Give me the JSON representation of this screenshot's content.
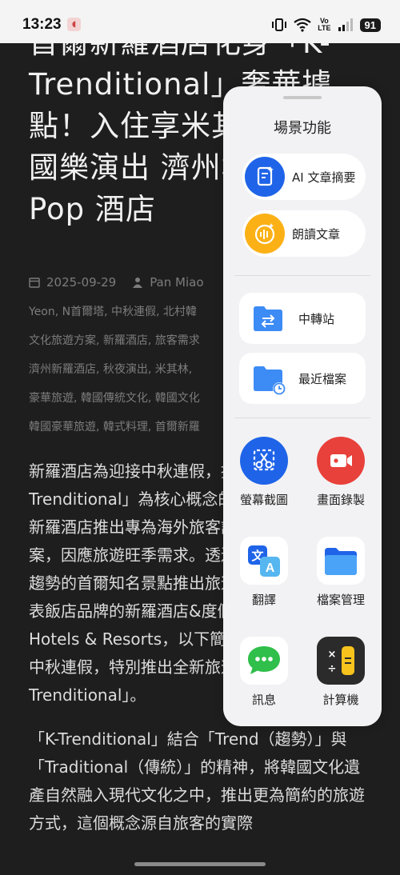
{
  "status": {
    "time": "13:23",
    "lte": "Vo\nLTE",
    "battery": "91"
  },
  "article": {
    "headline": "首爾新羅酒店化身「K-Trenditional」奢華據點！入住享米其林韓餐與國樂演出 濟州場推 K-Pop 酒店",
    "date": "2025-09-29",
    "author": "Pan Miao",
    "tag_lines": [
      "Yeon, N首爾塔, 中秋連假, 北村韓",
      "文化旅遊方案, 新羅酒店, 旅客需求",
      "濟州新羅酒店, 秋夜演出, 米其林,",
      "豪華旅遊, 韓國傳統文化, 韓國文化",
      "韓國豪華旅遊, 韓式料理, 首爾新羅"
    ],
    "paragraphs": [
      "新羅酒店為迎接中秋連假，推出以「K-Trenditional」為核心概念的旅遊新標準。首爾新羅酒店推出專為海外旅客設計的文化旅遊方案，因應旅遊旺季需求。透過結合韓國當代流行趨勢的首爾知名景點推出旅遊概念。身為韓國代表飯店品牌的新羅酒店&度假村（The Shilla Hotels & Resorts，以下簡稱「新羅」）為迎接中秋連假，特別推出全新旅遊概念「K-Trenditional」。",
      "「K-Trenditional」結合「Trend（趨勢）」與「Traditional（傳統）」的精神，將韓國文化遺產自然融入現代文化之中，推出更為簡約的旅遊方式，這個概念源自旅客的實際"
    ]
  },
  "panel": {
    "title": "場景功能",
    "ai_summary": "AI 文章摘要",
    "read_aloud": "朗讀文章",
    "transfer": "中轉站",
    "recent_files": "最近檔案",
    "apps": [
      {
        "label": "螢幕截圖",
        "icon": "scissors-icon"
      },
      {
        "label": "畫面錄製",
        "icon": "video-icon"
      },
      {
        "label": "翻譯",
        "icon": "translate-icon"
      },
      {
        "label": "檔案管理",
        "icon": "folder-icon"
      },
      {
        "label": "訊息",
        "icon": "message-icon"
      },
      {
        "label": "計算機",
        "icon": "calculator-icon"
      }
    ]
  },
  "colors": {
    "blue": "#1f64e8",
    "orange": "#fbb116",
    "red": "#e8403a",
    "folder_blue": "#3d8bf5"
  }
}
